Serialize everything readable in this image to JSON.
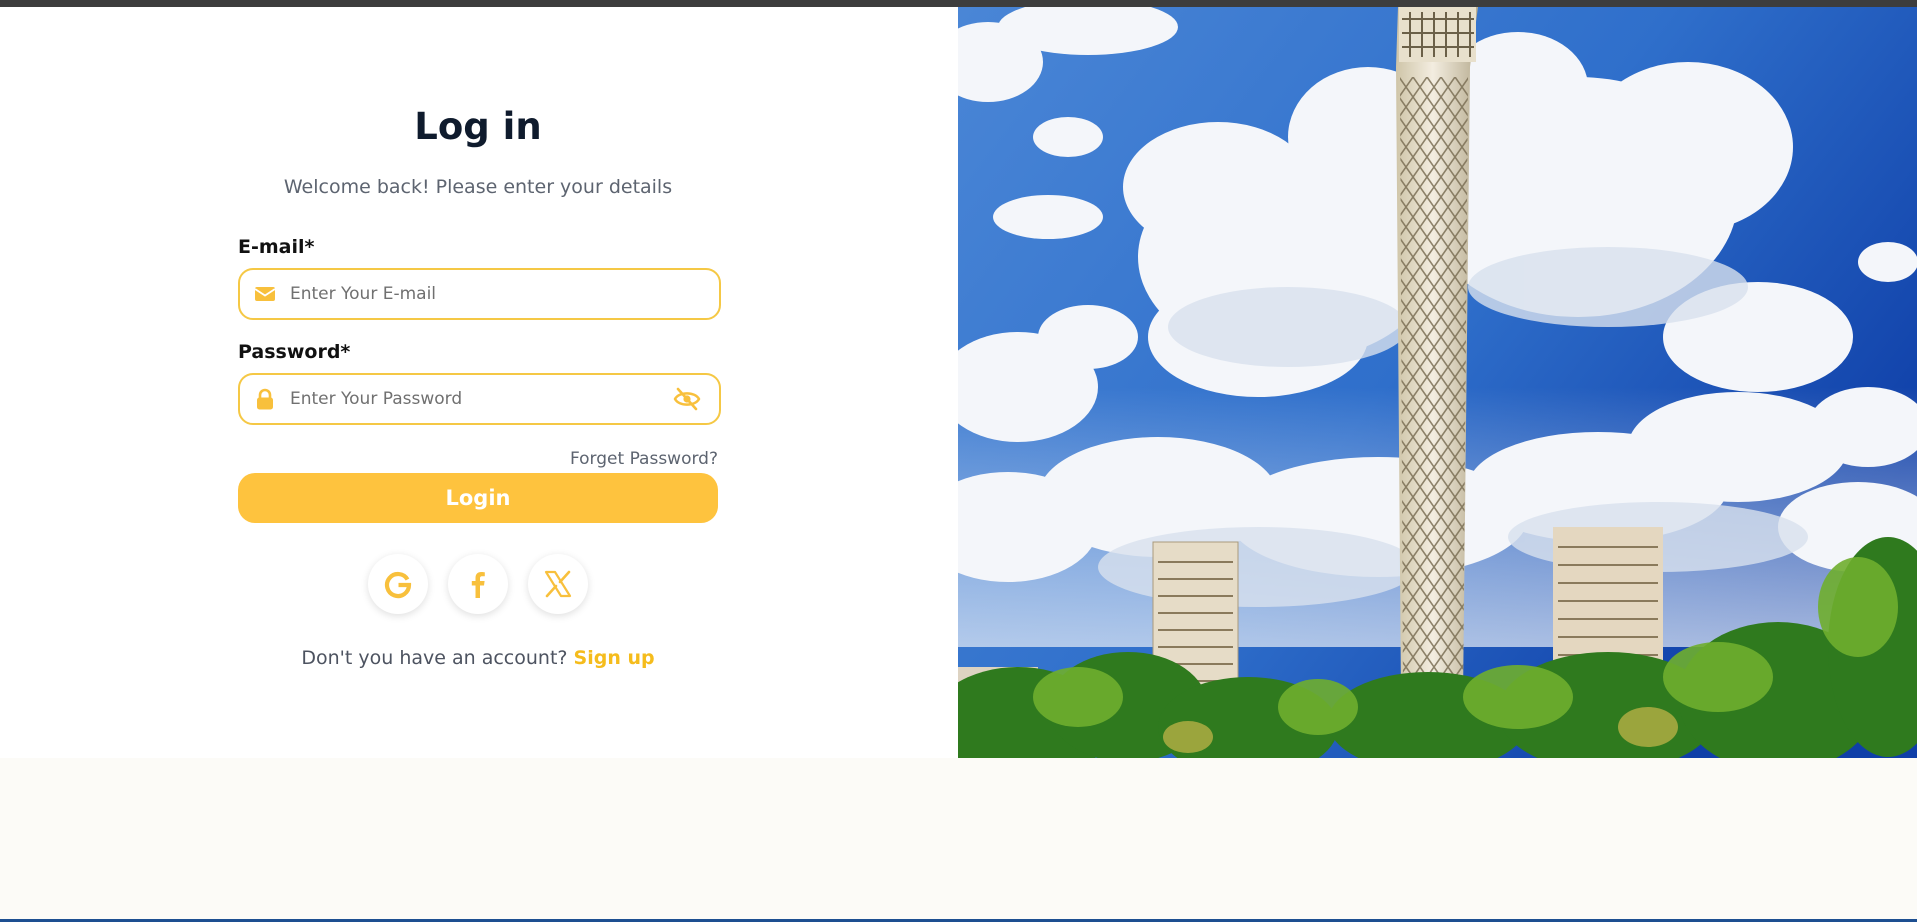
{
  "login": {
    "title": "Log in",
    "subtitle": "Welcome back! Please enter your details",
    "email_label": "E-mail*",
    "email_placeholder": "Enter Your E-mail",
    "email_value": "",
    "password_label": "Password*",
    "password_placeholder": "Enter Your Password",
    "password_value": "",
    "forgot_label": "Forget Password?",
    "submit_label": "Login",
    "social": [
      {
        "name": "google",
        "icon": "google-icon"
      },
      {
        "name": "facebook",
        "icon": "facebook-icon"
      },
      {
        "name": "x",
        "icon": "x-icon"
      }
    ],
    "signup_prompt": "Don't you have an account?",
    "signup_link": "Sign up"
  },
  "hero": {
    "icon": "cairo-tower-photo"
  },
  "colors": {
    "accent": "#fec33e",
    "input_border": "#f5c845",
    "link": "#f5bc1c",
    "title": "#0f1b2d",
    "muted_text": "#5d6470",
    "page_bg": "#fcfbf7",
    "top_bar": "#3d3d3d",
    "bottom_bar": "#1d4f91"
  }
}
